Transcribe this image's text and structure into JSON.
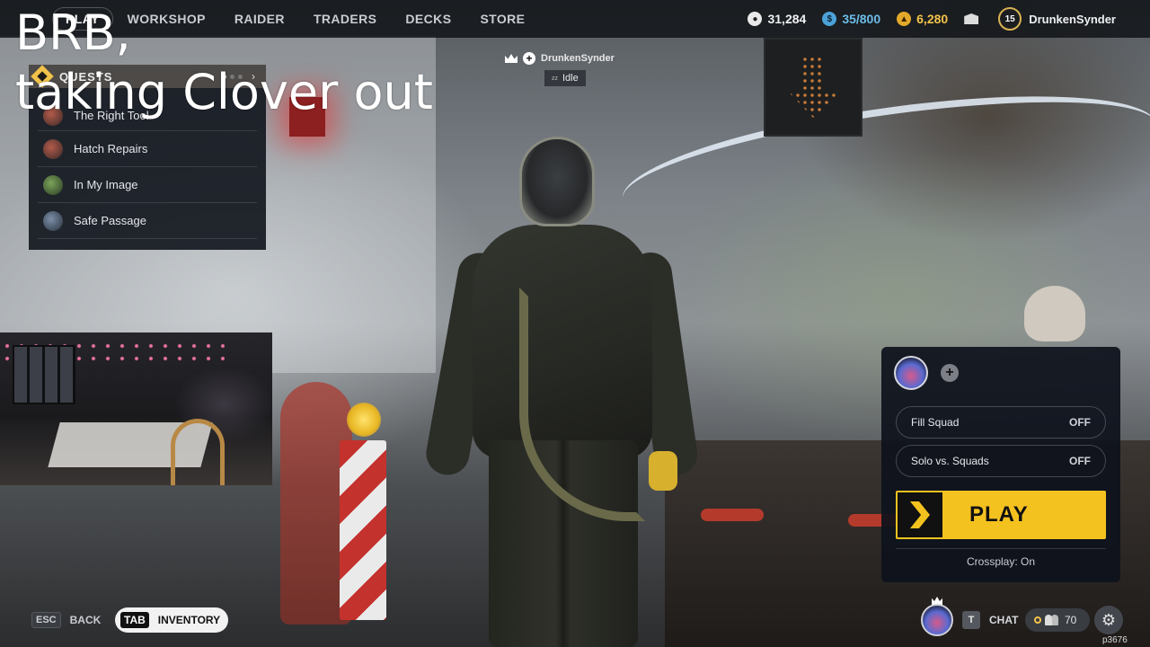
{
  "nav": {
    "items": [
      {
        "label": "PLAY",
        "active": true
      },
      {
        "label": "WORKSHOP"
      },
      {
        "label": "RAIDER"
      },
      {
        "label": "TRADERS"
      },
      {
        "label": "DECKS"
      },
      {
        "label": "STORE"
      }
    ]
  },
  "currencies": {
    "coins": "31,284",
    "creds": "35/800",
    "raider_tokens": "6,280"
  },
  "player": {
    "level": "15",
    "name": "DrunkenSynder"
  },
  "quests": {
    "title": "QUESTS",
    "items": [
      {
        "label": "The Right Tool"
      },
      {
        "label": "Hatch Repairs"
      },
      {
        "label": "In My Image"
      },
      {
        "label": "Safe Passage"
      }
    ]
  },
  "overlay": {
    "brb_line1": "BRB,",
    "brb_line2": "taking Clover out"
  },
  "lobby_player": {
    "name": "DrunkenSynder",
    "status": "Idle"
  },
  "squad": {
    "fill_squad_label": "Fill Squad",
    "fill_squad_state": "OFF",
    "solo_label": "Solo vs. Squads",
    "solo_state": "OFF",
    "play_label": "PLAY",
    "crossplay": "Crossplay: On"
  },
  "bottom": {
    "back_key": "ESC",
    "back_label": "BACK",
    "inventory_key": "TAB",
    "inventory_label": "INVENTORY",
    "chat_key": "T",
    "chat_label": "CHAT",
    "friends_online": "70",
    "build_id": "p3676"
  },
  "colors": {
    "accent_yellow": "#f4c21f",
    "creds_blue": "#6cbde8",
    "raider_gold": "#f3c24a",
    "panel_bg": "#0e121c"
  },
  "icons": [
    "coin-icon",
    "creds-icon",
    "raider-token-icon",
    "mail-icon",
    "crown-icon",
    "plus-icon",
    "people-icon",
    "gear-icon",
    "play-chevron-icon",
    "quest-diamond-icon"
  ]
}
